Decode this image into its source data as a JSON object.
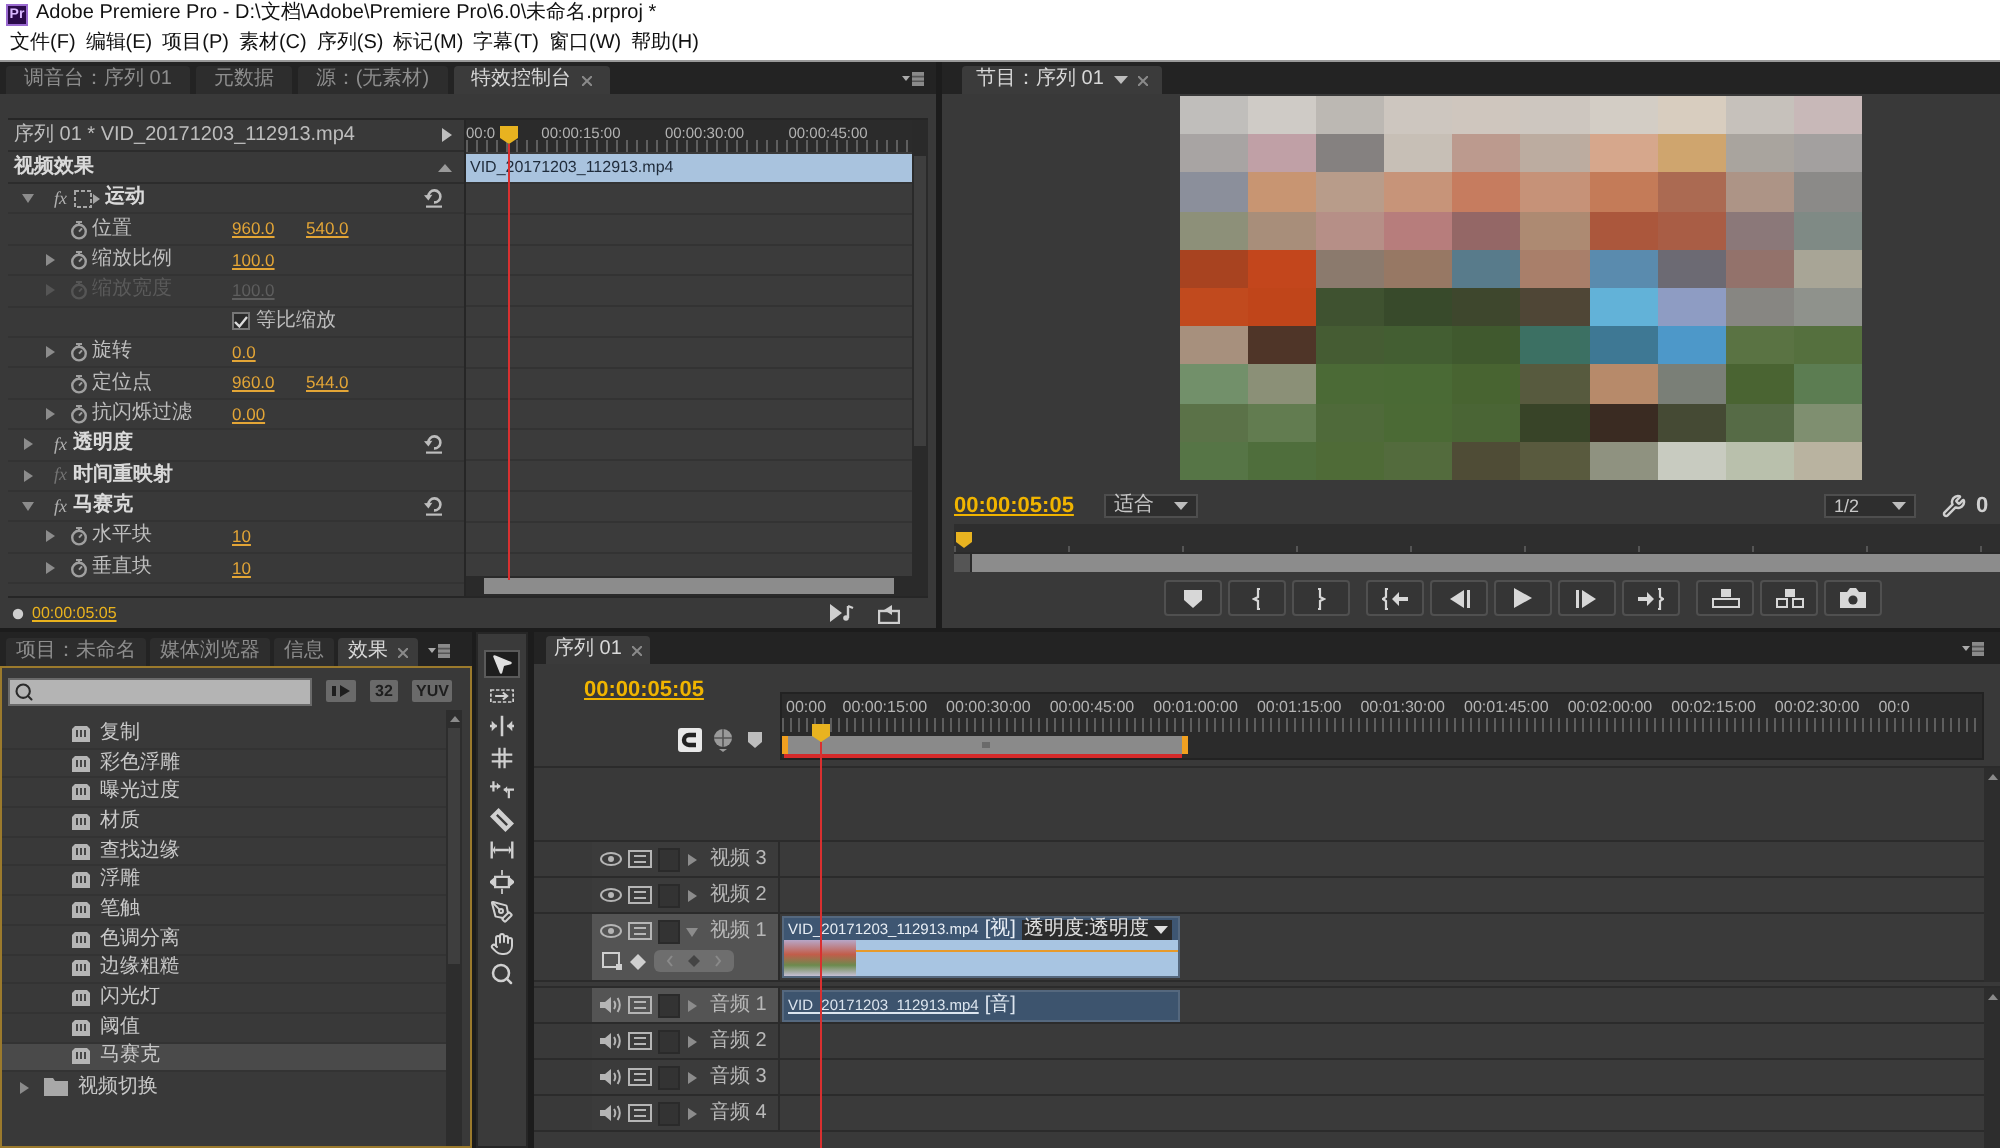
{
  "window": {
    "logo": "Pr",
    "title": "Adobe Premiere Pro - D:\\文档\\Adobe\\Premiere Pro\\6.0\\未命名.prproj *"
  },
  "menu": [
    "文件(F)",
    "编辑(E)",
    "项目(P)",
    "素材(C)",
    "序列(S)",
    "标记(M)",
    "字幕(T)",
    "窗口(W)",
    "帮助(H)"
  ],
  "top_left_panel": {
    "tabs": [
      {
        "label": "调音台：序列 01",
        "selected": false
      },
      {
        "label": "元数据",
        "selected": false
      },
      {
        "label": "源：(无素材)",
        "selected": false
      },
      {
        "label": "特效控制台",
        "selected": true
      }
    ]
  },
  "effect_controls": {
    "clip_header": "序列 01 * VID_20171203_112913.mp4",
    "section": "视频效果",
    "effects": [
      {
        "kind": "motion",
        "badge": "fx",
        "fx_active": true,
        "name": "运动",
        "expanded": true,
        "reset": true,
        "children": [
          {
            "kind": "param",
            "name": "位置",
            "expandable": false,
            "disabled": false,
            "values": [
              "960.0",
              "540.0"
            ]
          },
          {
            "kind": "param",
            "name": "缩放比例",
            "expandable": true,
            "disabled": false,
            "values": [
              "100.0"
            ]
          },
          {
            "kind": "param",
            "name": "缩放宽度",
            "expandable": true,
            "disabled": true,
            "values": [
              "100.0"
            ]
          },
          {
            "kind": "checkbox",
            "name": "等比缩放",
            "checked": true
          },
          {
            "kind": "param",
            "name": "旋转",
            "expandable": true,
            "disabled": false,
            "values": [
              "0.0"
            ]
          },
          {
            "kind": "param",
            "name": "定位点",
            "expandable": false,
            "disabled": false,
            "values": [
              "960.0",
              "544.0"
            ]
          },
          {
            "kind": "param",
            "name": "抗闪烁过滤",
            "expandable": true,
            "disabled": false,
            "values": [
              "0.00"
            ]
          }
        ]
      },
      {
        "kind": "effect",
        "badge": "fx",
        "fx_active": true,
        "name": "透明度",
        "expanded": false,
        "reset": true
      },
      {
        "kind": "effect",
        "badge": "fx",
        "fx_active": false,
        "name": "时间重映射",
        "expanded": false,
        "reset": false
      },
      {
        "kind": "effect",
        "badge": "fx",
        "fx_active": true,
        "name": "马赛克",
        "expanded": true,
        "reset": true,
        "children": [
          {
            "kind": "param",
            "name": "水平块",
            "expandable": true,
            "disabled": false,
            "values": [
              "10"
            ]
          },
          {
            "kind": "param",
            "name": "垂直块",
            "expandable": true,
            "disabled": false,
            "values": [
              "10"
            ]
          }
        ]
      }
    ],
    "ruler": [
      "00:0",
      "00:00:15:00",
      "00:00:30:00",
      "00:00:45:00"
    ],
    "clip": "VID_20171203_112913.mp4",
    "timecode": "00:00:05:05"
  },
  "program_monitor": {
    "tab": "节目：序列 01",
    "timecode": "00:00:05:05",
    "zoom": "适合",
    "resolution": "1/2",
    "duration_cut": "0"
  },
  "effects_panel": {
    "tabs": [
      {
        "label": "项目：未命名",
        "selected": false
      },
      {
        "label": "媒体浏览器",
        "selected": false
      },
      {
        "label": "信息",
        "selected": false
      },
      {
        "label": "效果",
        "selected": true
      }
    ],
    "filters": [
      "32",
      "YUV"
    ],
    "items": [
      {
        "name": "复制",
        "selected": false
      },
      {
        "name": "彩色浮雕",
        "selected": false
      },
      {
        "name": "曝光过度",
        "selected": false
      },
      {
        "name": "材质",
        "selected": false
      },
      {
        "name": "查找边缘",
        "selected": false
      },
      {
        "name": "浮雕",
        "selected": false
      },
      {
        "name": "笔触",
        "selected": false
      },
      {
        "name": "色调分离",
        "selected": false
      },
      {
        "name": "边缘粗糙",
        "selected": false
      },
      {
        "name": "闪光灯",
        "selected": false
      },
      {
        "name": "阈值",
        "selected": false
      },
      {
        "name": "马赛克",
        "selected": true
      }
    ],
    "folders": [
      {
        "name": "视频切换",
        "expanded": false
      }
    ]
  },
  "tools": [
    {
      "kind": "selection",
      "selected": true
    },
    {
      "kind": "track_select",
      "selected": false
    },
    {
      "kind": "ripple",
      "selected": false
    },
    {
      "kind": "rolling",
      "selected": false
    },
    {
      "kind": "rate_stretch",
      "selected": false
    },
    {
      "kind": "razor",
      "selected": false
    },
    {
      "kind": "slip",
      "selected": false
    },
    {
      "kind": "slide",
      "selected": false
    },
    {
      "kind": "pen",
      "selected": false
    },
    {
      "kind": "hand",
      "selected": false
    },
    {
      "kind": "zoom",
      "selected": false
    }
  ],
  "timeline": {
    "tab": "序列 01",
    "timecode": "00:00:05:05",
    "ruler": [
      "00:00",
      "00:00:15:00",
      "00:00:30:00",
      "00:00:45:00",
      "00:01:00:00",
      "00:01:15:00",
      "00:01:30:00",
      "00:01:45:00",
      "00:02:00:00",
      "00:02:15:00",
      "00:02:30:00",
      "00:0"
    ],
    "tracks": [
      {
        "kind": "video",
        "name": "视频 3",
        "expanded": false,
        "targeted": false
      },
      {
        "kind": "video",
        "name": "视频 2",
        "expanded": false,
        "targeted": false
      },
      {
        "kind": "video",
        "name": "视频 1",
        "expanded": true,
        "targeted": true,
        "clip": {
          "name": "VID_20171203_112913.mp4",
          "tag": "[视]",
          "property": "透明度:透明度"
        }
      },
      {
        "kind": "audio",
        "name": "音频 1",
        "expanded": false,
        "targeted": true,
        "clip": {
          "name": "VID_20171203_112913.mp4",
          "tag": "[音]"
        }
      },
      {
        "kind": "audio",
        "name": "音频 2",
        "expanded": false,
        "targeted": false
      },
      {
        "kind": "audio",
        "name": "音频 3",
        "expanded": false,
        "targeted": false
      },
      {
        "kind": "audio",
        "name": "音频 4",
        "expanded": false,
        "targeted": false
      }
    ]
  }
}
